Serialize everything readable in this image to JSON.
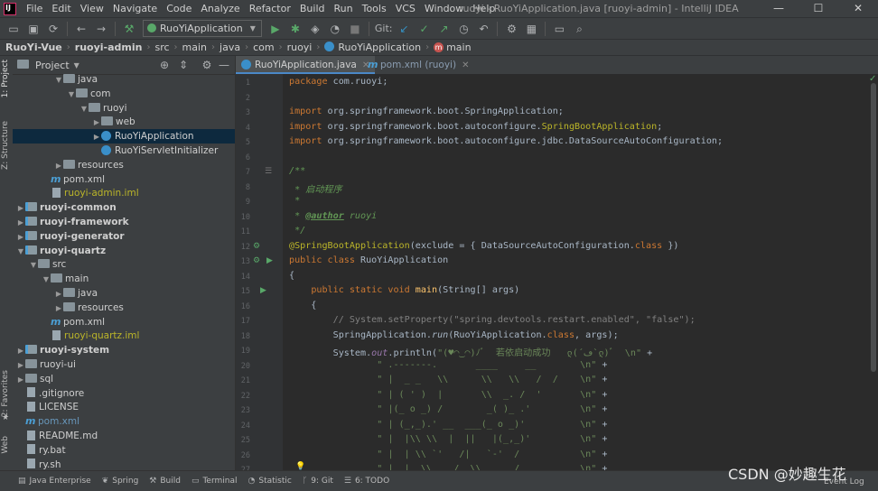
{
  "window": {
    "title": "ruoyi - RuoYiApplication.java [ruoyi-admin] - IntelliJ IDEA",
    "minimize": "—",
    "maximize": "☐",
    "close": "✕"
  },
  "menu": [
    "File",
    "Edit",
    "View",
    "Navigate",
    "Code",
    "Analyze",
    "Refactor",
    "Build",
    "Run",
    "Tools",
    "VCS",
    "Window",
    "Help"
  ],
  "toolbar": {
    "run_config": "RuoYiApplication",
    "git_label": "Git:"
  },
  "breadcrumbs": [
    "RuoYi-Vue",
    "ruoyi-admin",
    "src",
    "main",
    "java",
    "com",
    "ruoyi",
    "RuoYiApplication",
    "main"
  ],
  "side_tabs": {
    "project": "1: Project",
    "structure": "Z: Structure",
    "favorites": "2: Favorites",
    "web": "Web"
  },
  "project_panel": {
    "title": "Project",
    "tree": [
      {
        "label": "java",
        "indent": 4,
        "kind": "folder",
        "arrow": "down"
      },
      {
        "label": "com",
        "indent": 5,
        "kind": "pkg",
        "arrow": "down"
      },
      {
        "label": "ruoyi",
        "indent": 6,
        "kind": "pkg",
        "arrow": "down"
      },
      {
        "label": "web",
        "indent": 7,
        "kind": "pkg",
        "arrow": "right"
      },
      {
        "label": "RuoYiApplication",
        "indent": 7,
        "kind": "class",
        "arrow": "right",
        "selected": true
      },
      {
        "label": "RuoYiServletInitializer",
        "indent": 7,
        "kind": "class",
        "arrow": "none"
      },
      {
        "label": "resources",
        "indent": 4,
        "kind": "folder",
        "arrow": "right"
      },
      {
        "label": "pom.xml",
        "indent": 3,
        "kind": "maven",
        "arrow": "none"
      },
      {
        "label": "ruoyi-admin.iml",
        "indent": 3,
        "kind": "iml",
        "arrow": "none"
      },
      {
        "label": "ruoyi-common",
        "indent": 1,
        "kind": "module",
        "arrow": "right",
        "bold": true
      },
      {
        "label": "ruoyi-framework",
        "indent": 1,
        "kind": "module",
        "arrow": "right",
        "bold": true
      },
      {
        "label": "ruoyi-generator",
        "indent": 1,
        "kind": "module",
        "arrow": "right",
        "bold": true
      },
      {
        "label": "ruoyi-quartz",
        "indent": 1,
        "kind": "module",
        "arrow": "down",
        "bold": true
      },
      {
        "label": "src",
        "indent": 2,
        "kind": "folder",
        "arrow": "down"
      },
      {
        "label": "main",
        "indent": 3,
        "kind": "folder",
        "arrow": "down"
      },
      {
        "label": "java",
        "indent": 4,
        "kind": "folder",
        "arrow": "right"
      },
      {
        "label": "resources",
        "indent": 4,
        "kind": "folder",
        "arrow": "right"
      },
      {
        "label": "pom.xml",
        "indent": 3,
        "kind": "maven",
        "arrow": "none"
      },
      {
        "label": "ruoyi-quartz.iml",
        "indent": 3,
        "kind": "iml",
        "arrow": "none"
      },
      {
        "label": "ruoyi-system",
        "indent": 1,
        "kind": "module",
        "arrow": "right",
        "bold": true
      },
      {
        "label": "ruoyi-ui",
        "indent": 1,
        "kind": "folder",
        "arrow": "right"
      },
      {
        "label": "sql",
        "indent": 1,
        "kind": "folder",
        "arrow": "right"
      },
      {
        "label": ".gitignore",
        "indent": 1,
        "kind": "file",
        "arrow": "none"
      },
      {
        "label": "LICENSE",
        "indent": 1,
        "kind": "file",
        "arrow": "none"
      },
      {
        "label": "pom.xml",
        "indent": 1,
        "kind": "maven-blue",
        "arrow": "none"
      },
      {
        "label": "README.md",
        "indent": 1,
        "kind": "file",
        "arrow": "none"
      },
      {
        "label": "ry.bat",
        "indent": 1,
        "kind": "file",
        "arrow": "none"
      },
      {
        "label": "ry.sh",
        "indent": 1,
        "kind": "file",
        "arrow": "none"
      }
    ]
  },
  "editor_tabs": [
    {
      "label": "RuoYiApplication.java",
      "active": true
    },
    {
      "label": "pom.xml (ruoyi)",
      "active": false
    }
  ],
  "code": {
    "line_numbers": [
      "1",
      "2",
      "3",
      "4",
      "5",
      "6",
      "7",
      "8",
      "9",
      "10",
      "11",
      "12",
      "13",
      "14",
      "15",
      "16",
      "17",
      "18",
      "19",
      "20",
      "21",
      "22",
      "23",
      "24",
      "25",
      "26",
      "27"
    ],
    "lines": [
      [
        [
          "kw",
          "package "
        ],
        [
          "",
          "com.ruoyi;"
        ]
      ],
      [],
      [
        [
          "kw",
          "import "
        ],
        [
          "",
          "org.springframework.boot.SpringApplication;"
        ]
      ],
      [
        [
          "kw",
          "import "
        ],
        [
          "",
          "org.springframework.boot.autoconfigure."
        ],
        [
          "ann",
          "SpringBootApplication"
        ],
        [
          "",
          ";"
        ]
      ],
      [
        [
          "kw",
          "import "
        ],
        [
          "",
          "org.springframework.boot.autoconfigure.jdbc.DataSourceAutoConfiguration;"
        ]
      ],
      [],
      [
        [
          "doc",
          "/**"
        ]
      ],
      [
        [
          "doc",
          " * 启动程序"
        ]
      ],
      [
        [
          "doc",
          " *"
        ]
      ],
      [
        [
          "doc",
          " * "
        ],
        [
          "doctag",
          "@author"
        ],
        [
          "doc",
          " ruoyi"
        ]
      ],
      [
        [
          "doc",
          " */"
        ]
      ],
      [
        [
          "ann",
          "@SpringBootApplication"
        ],
        [
          "",
          "(exclude = { DataSourceAutoConfiguration."
        ],
        [
          "kw",
          "class"
        ],
        [
          "",
          " })"
        ]
      ],
      [
        [
          "kw",
          "public class "
        ],
        [
          "",
          "RuoYiApplication"
        ]
      ],
      [
        [
          "",
          "{"
        ]
      ],
      [
        [
          "",
          "    "
        ],
        [
          "kw",
          "public static void "
        ],
        [
          "fn",
          "main"
        ],
        [
          "",
          "(String[] args)"
        ]
      ],
      [
        [
          "",
          "    {"
        ]
      ],
      [
        [
          "",
          "        "
        ],
        [
          "cmt",
          "// System.setProperty(\"spring.devtools.restart.enabled\", \"false\");"
        ]
      ],
      [
        [
          "",
          "        SpringApplication."
        ],
        [
          "it",
          "run"
        ],
        [
          "",
          "(RuoYiApplication."
        ],
        [
          "kw",
          "class"
        ],
        [
          "",
          ", args);"
        ]
      ],
      [
        [
          "",
          "        System."
        ],
        [
          "fld",
          "out"
        ],
        [
          "",
          ".println("
        ],
        [
          "str",
          "\"(♥◠‿◠)ﾉﾞ  若依启动成功   ლ(´ڡ`ლ)ﾞ  \\n\""
        ],
        [
          "",
          " +"
        ]
      ],
      [
        [
          "",
          "                "
        ],
        [
          "str",
          "\" .-------.       ____     __        \\n\""
        ],
        [
          "",
          " +"
        ]
      ],
      [
        [
          "",
          "                "
        ],
        [
          "str",
          "\" |  _ _   \\\\      \\\\   \\\\   /  /    \\n\""
        ],
        [
          "",
          " +"
        ]
      ],
      [
        [
          "",
          "                "
        ],
        [
          "str",
          "\" | ( ' )  |       \\\\  _. /  '       \\n\""
        ],
        [
          "",
          " +"
        ]
      ],
      [
        [
          "",
          "                "
        ],
        [
          "str",
          "\" |(_ o _) /        _( )_ .'         \\n\""
        ],
        [
          "",
          " +"
        ]
      ],
      [
        [
          "",
          "                "
        ],
        [
          "str",
          "\" | (_,_).' __  ___(_ o _)'          \\n\""
        ],
        [
          "",
          " +"
        ]
      ],
      [
        [
          "",
          "                "
        ],
        [
          "str",
          "\" |  |\\\\ \\\\  |  ||   |(_,_)'         \\n\""
        ],
        [
          "",
          " +"
        ]
      ],
      [
        [
          "",
          "                "
        ],
        [
          "str",
          "\" |  | \\\\ `'   /|   `-'  /           \\n\""
        ],
        [
          "",
          " +"
        ]
      ],
      [
        [
          "",
          "                "
        ],
        [
          "str",
          "\" |  |  \\\\    /  \\\\      /           \\n\""
        ],
        [
          "",
          " +"
        ]
      ]
    ]
  },
  "statusbar": [
    {
      "label": "Java Enterprise",
      "icon": "▤"
    },
    {
      "label": "Spring",
      "icon": "❦"
    },
    {
      "label": "Build",
      "icon": "⚒"
    },
    {
      "label": "Terminal",
      "icon": "▭"
    },
    {
      "label": "Statistic",
      "icon": "◔"
    },
    {
      "label": "9: Git",
      "icon": "ᚴ"
    },
    {
      "label": "6: TODO",
      "icon": "☰"
    }
  ],
  "event_log": "Event Log",
  "watermark": "CSDN @妙趣生花"
}
